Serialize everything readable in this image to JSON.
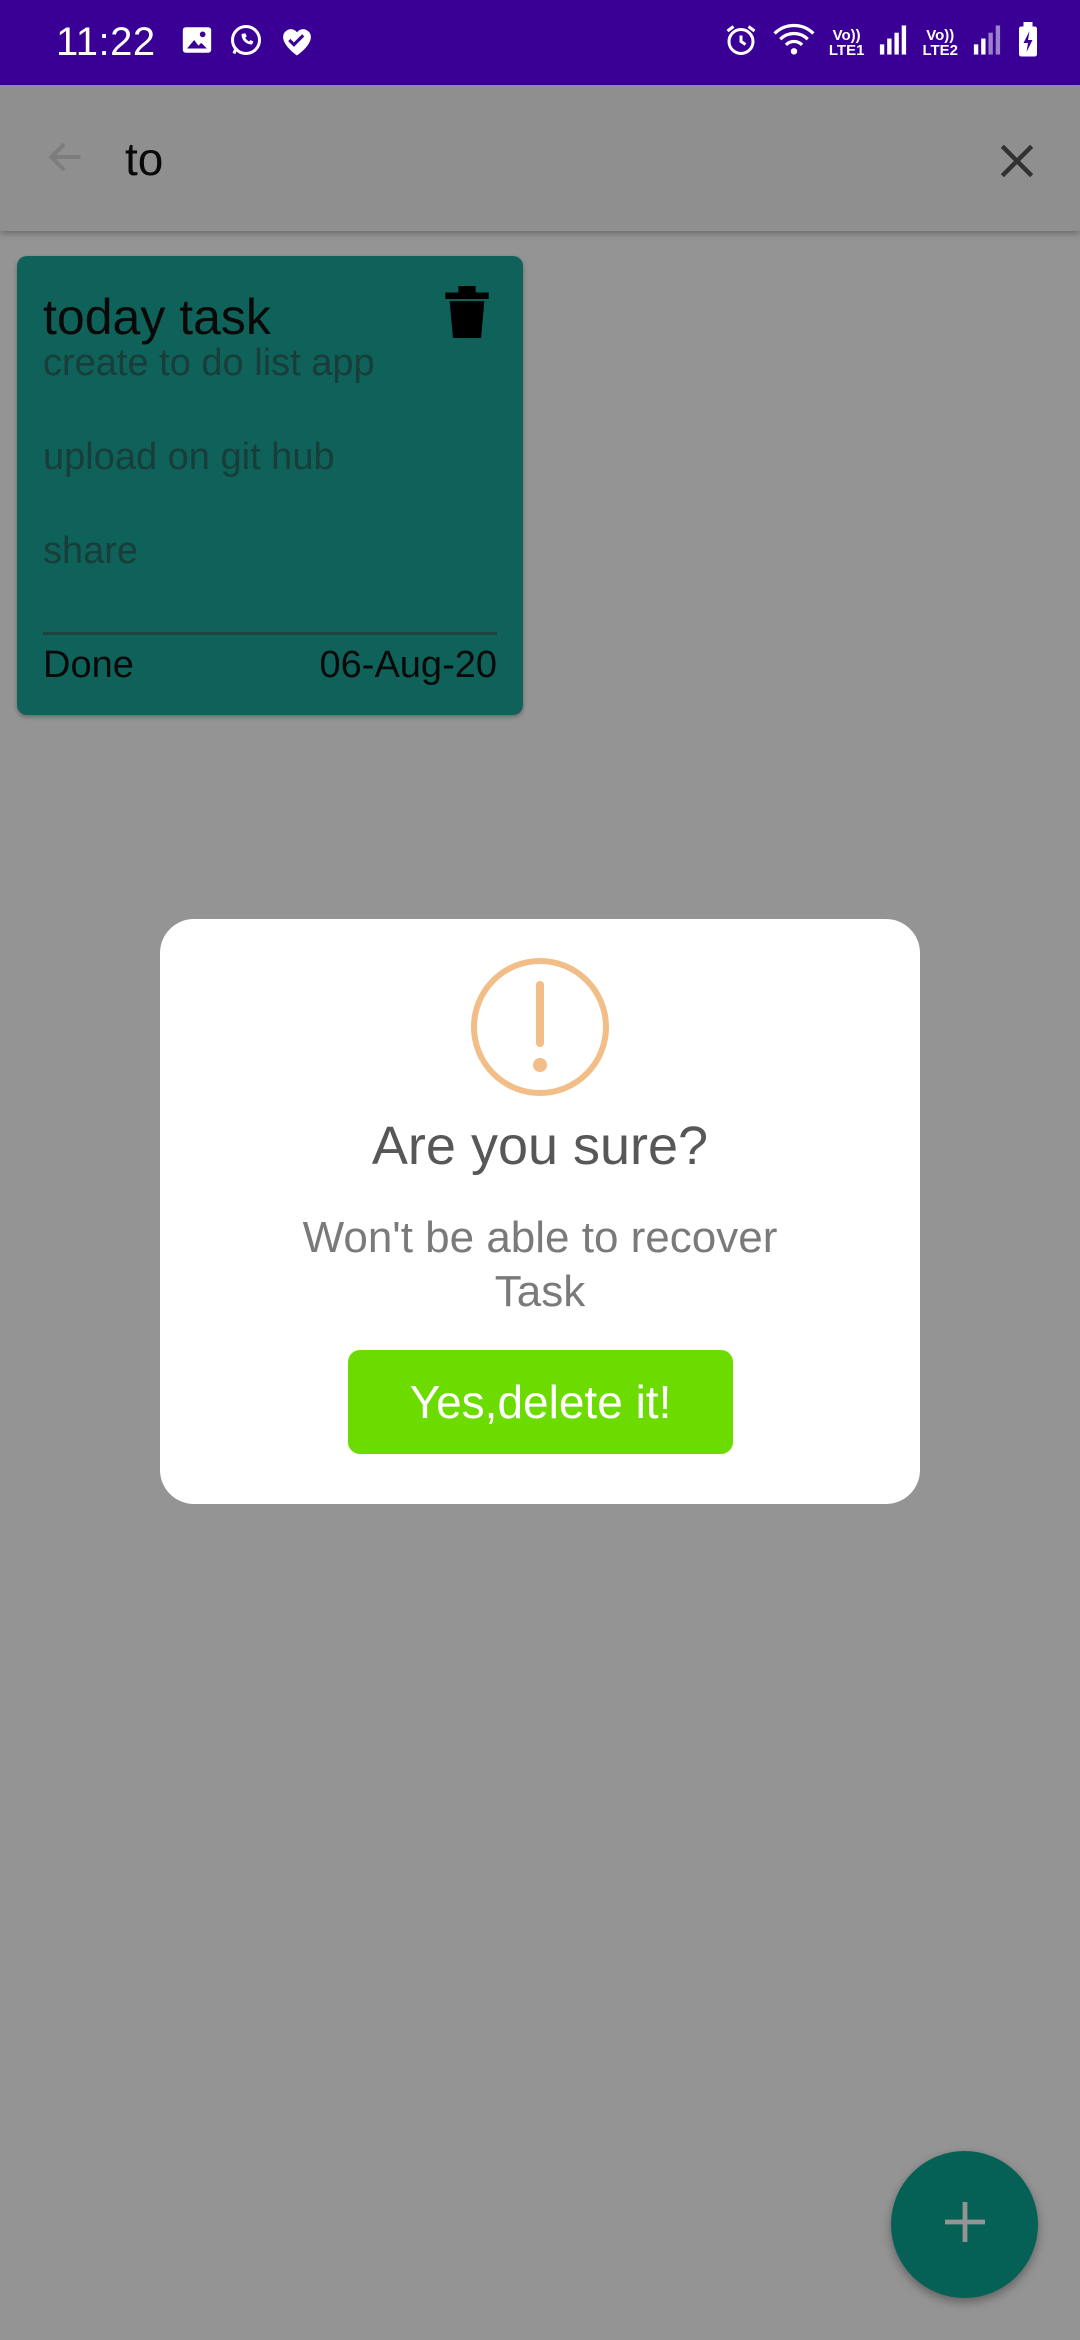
{
  "status_bar": {
    "time": "11:22",
    "left_icons": [
      "image-icon",
      "whatsapp-icon",
      "heart-check-icon"
    ],
    "sim1_label_top": "Vo))",
    "sim1_label_bottom": "LTE1",
    "sim2_label_top": "Vo))",
    "sim2_label_bottom": "LTE2",
    "background_color": "#3a0096"
  },
  "search_bar": {
    "query": "to",
    "back_icon": "arrow-left-icon",
    "clear_icon": "close-icon"
  },
  "note": {
    "title": "today task",
    "lines": [
      "create to do list app",
      "upload on git hub",
      "share"
    ],
    "status": "Done",
    "date": "06-Aug-20",
    "color": "#1aa99a",
    "delete_icon": "trash-icon"
  },
  "fab": {
    "icon": "plus-icon",
    "color": "#0aa593"
  },
  "dialog": {
    "icon": "warning-icon",
    "icon_color": "#f2bd86",
    "title": "Are you sure?",
    "message": "Won't be able to recover Task",
    "confirm_label": "Yes,delete it!",
    "confirm_color": "#6cdc00"
  }
}
